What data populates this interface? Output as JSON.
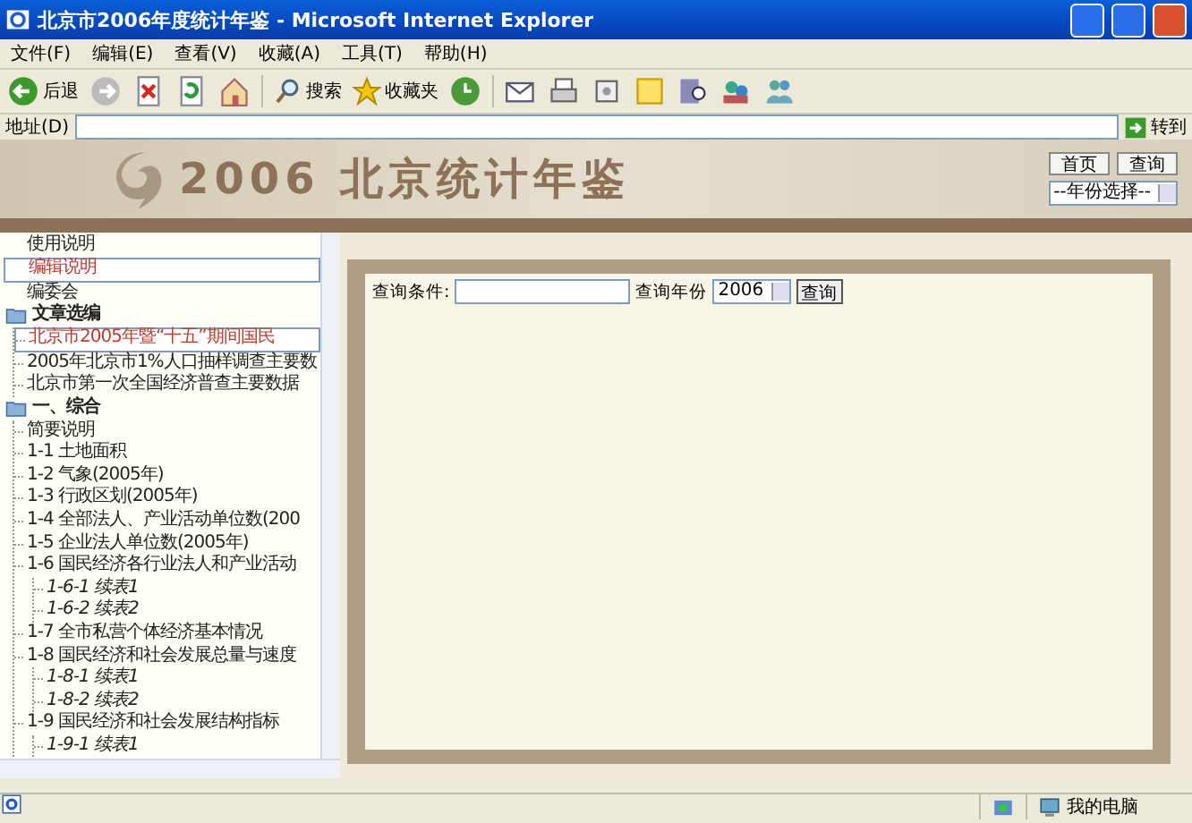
{
  "window": {
    "title": "北京市2006年度统计年鉴 - Microsoft Internet Explorer"
  },
  "menu": [
    "文件(F)",
    "编辑(E)",
    "查看(V)",
    "收藏(A)",
    "工具(T)",
    "帮助(H)"
  ],
  "toolbar": {
    "back": "后退",
    "search": "搜索",
    "favorites": "收藏夹"
  },
  "address_bar": {
    "label": "地址(D)",
    "go": "转到"
  },
  "header": {
    "title": "2006 北京统计年鉴",
    "buttons": [
      "首页",
      "查询"
    ],
    "year_select": "--年份选择--"
  },
  "tree": [
    {
      "label": "使用说明",
      "selected": false,
      "kind": "link"
    },
    {
      "label": "编辑说明",
      "selected": true,
      "kind": "link"
    },
    {
      "label": "编委会",
      "selected": false,
      "kind": "link"
    },
    {
      "label": "文章选编",
      "kind": "folder",
      "children": [
        {
          "label": "北京市2005年暨“十五”期间国民",
          "selected": true
        },
        {
          "label": "2005年北京市1%人口抽样调查主要数",
          "selected": false
        },
        {
          "label": "北京市第一次全国经济普查主要数据",
          "selected": false
        }
      ]
    },
    {
      "label": "一、综合",
      "kind": "folder",
      "children": [
        {
          "label": "简要说明",
          "selected": false
        },
        {
          "label": "1-1 土地面积",
          "selected": false
        },
        {
          "label": "1-2 气象(2005年)",
          "selected": false
        },
        {
          "label": "1-3 行政区划(2005年)",
          "selected": false
        },
        {
          "label": "1-4 全部法人、产业活动单位数(200",
          "selected": false
        },
        {
          "label": "1-5 企业法人单位数(2005年)",
          "selected": false
        },
        {
          "label": "1-6 国民经济各行业法人和产业活动",
          "selected": false,
          "children": [
            {
              "label": "1-6-1 续表1",
              "selected": false
            },
            {
              "label": "1-6-2 续表2",
              "selected": false
            }
          ]
        },
        {
          "label": "1-7 全市私营个体经济基本情况",
          "selected": false
        },
        {
          "label": "1-8 国民经济和社会发展总量与速度",
          "selected": false,
          "children": [
            {
              "label": "1-8-1 续表1",
              "selected": false
            },
            {
              "label": "1-8-2 续表2",
              "selected": false
            }
          ]
        },
        {
          "label": "1-9 国民经济和社会发展结构指标",
          "selected": false,
          "children": [
            {
              "label": "1-9-1 续表1",
              "selected": false
            }
          ]
        }
      ]
    }
  ],
  "query": {
    "condition_label": "查询条件:",
    "year_label": "查询年份",
    "year": "2006",
    "button": "查询"
  },
  "status_bar": {
    "zone": "我的电脑"
  }
}
